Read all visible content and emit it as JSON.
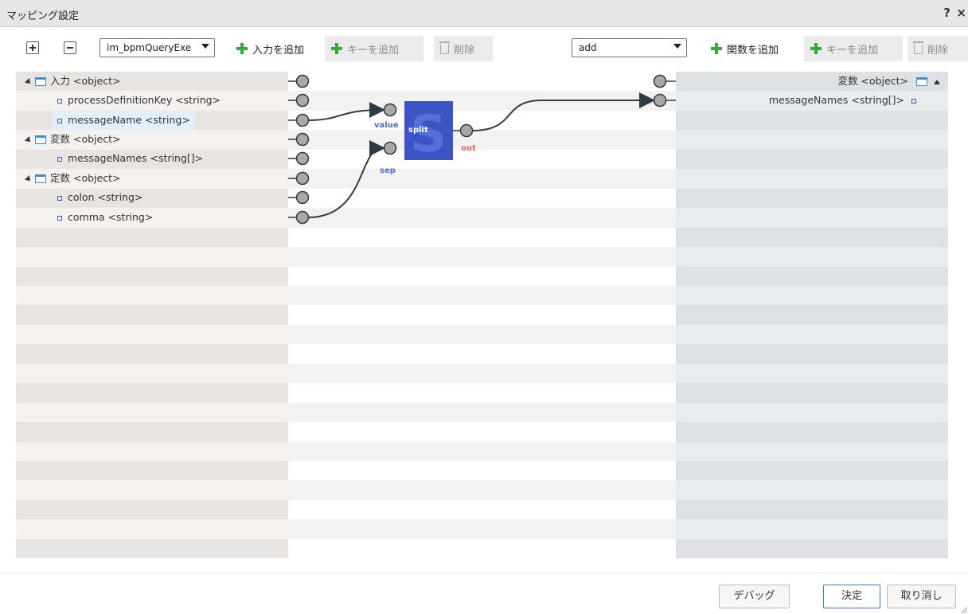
{
  "window": {
    "title": "マッピング設定",
    "help": "?",
    "close": "×"
  },
  "toolbar": {
    "source_select": "im_bpmQueryExe",
    "add_input": "入力を追加",
    "add_key_left": "キーを追加",
    "delete_left": "削除",
    "function_select": "add",
    "add_function": "関数を追加",
    "add_key_right": "キーを追加",
    "delete_right": "削除"
  },
  "source_tree": [
    {
      "label": "入力 <object>"
    },
    {
      "label": "processDefinitionKey <string>"
    },
    {
      "label": "messageName <string>"
    },
    {
      "label": "変数 <object>"
    },
    {
      "label": "messageNames <string[]>"
    },
    {
      "label": "定数 <object>"
    },
    {
      "label": "colon <string>"
    },
    {
      "label": "comma <string>"
    }
  ],
  "target_tree": [
    {
      "label": "変数 <object>"
    },
    {
      "label": "messageNames <string[]>"
    }
  ],
  "function_node": {
    "name": "split",
    "inputs": [
      "value",
      "sep"
    ],
    "output": "out",
    "input_color": "#4a6fd8",
    "output_color": "#e06666",
    "block_color": "#3b55c6"
  },
  "colors": {
    "source_band_a": "#e8e4e2",
    "source_band_b": "#f4f1ef",
    "target_band_a": "#dde1e5",
    "target_band_b": "#e9ecef",
    "middle_band_b": "#f2f2f2",
    "connector": "#2f3b42"
  },
  "footer": {
    "debug": "デバッグ",
    "ok": "決定",
    "cancel": "取り消し"
  }
}
